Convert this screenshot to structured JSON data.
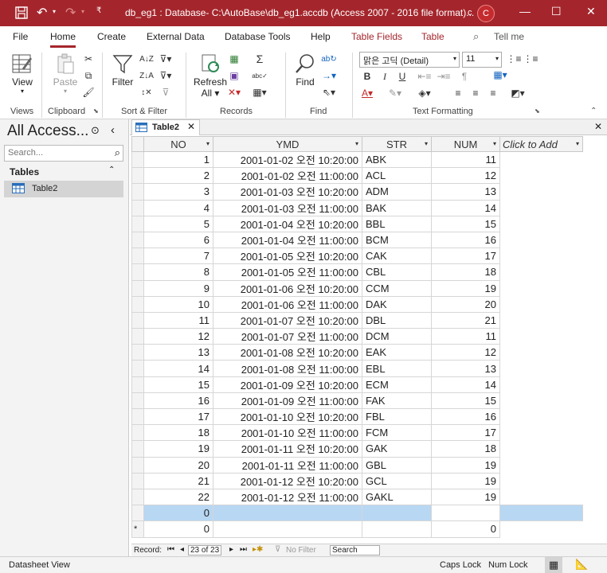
{
  "window": {
    "title": "db_eg1 : Database- C:\\AutoBase\\db_eg1.accdb (Access 2007 - 2016 file format)...",
    "user_initial_small": "c",
    "user_avatar": "C"
  },
  "menu_tabs": [
    "File",
    "Home",
    "Create",
    "External Data",
    "Database Tools",
    "Help",
    "Table Fields",
    "Table"
  ],
  "tell_me": "Tell me",
  "ribbon": {
    "view": "View",
    "paste": "Paste",
    "filter": "Filter",
    "refresh": "Refresh",
    "refresh_all": "All",
    "find": "Find",
    "font_name": "맑은 고딕 (Detail)",
    "font_size": "11",
    "groups": {
      "views": "Views",
      "clipboard": "Clipboard",
      "sort_filter": "Sort & Filter",
      "records": "Records",
      "find": "Find",
      "text_formatting": "Text Formatting"
    },
    "bold": "B",
    "italic": "I",
    "underline": "U"
  },
  "nav": {
    "title": "All Access...",
    "search_placeholder": "Search...",
    "section": "Tables",
    "items": [
      "Table2"
    ]
  },
  "doc_tab": "Table2",
  "grid": {
    "columns": [
      "NO",
      "YMD",
      "STR",
      "NUM",
      "Click to Add"
    ],
    "rows": [
      [
        "1",
        "2001-01-02 오전 10:20:00",
        "ABK",
        "11"
      ],
      [
        "2",
        "2001-01-02 오전 11:00:00",
        "ACL",
        "12"
      ],
      [
        "3",
        "2001-01-03 오전 10:20:00",
        "ADM",
        "13"
      ],
      [
        "4",
        "2001-01-03 오전 11:00:00",
        "BAK",
        "14"
      ],
      [
        "5",
        "2001-01-04 오전 10:20:00",
        "BBL",
        "15"
      ],
      [
        "6",
        "2001-01-04 오전 11:00:00",
        "BCM",
        "16"
      ],
      [
        "7",
        "2001-01-05 오전 10:20:00",
        "CAK",
        "17"
      ],
      [
        "8",
        "2001-01-05 오전 11:00:00",
        "CBL",
        "18"
      ],
      [
        "9",
        "2001-01-06 오전 10:20:00",
        "CCM",
        "19"
      ],
      [
        "10",
        "2001-01-06 오전 11:00:00",
        "DAK",
        "20"
      ],
      [
        "11",
        "2001-01-07 오전 10:20:00",
        "DBL",
        "21"
      ],
      [
        "12",
        "2001-01-07 오전 11:00:00",
        "DCM",
        "11"
      ],
      [
        "13",
        "2001-01-08 오전 10:20:00",
        "EAK",
        "12"
      ],
      [
        "14",
        "2001-01-08 오전 11:00:00",
        "EBL",
        "13"
      ],
      [
        "15",
        "2001-01-09 오전 10:20:00",
        "ECM",
        "14"
      ],
      [
        "16",
        "2001-01-09 오전 11:00:00",
        "FAK",
        "15"
      ],
      [
        "17",
        "2001-01-10 오전 10:20:00",
        "FBL",
        "16"
      ],
      [
        "18",
        "2001-01-10 오전 11:00:00",
        "FCM",
        "17"
      ],
      [
        "19",
        "2001-01-11 오전 10:20:00",
        "GAK",
        "18"
      ],
      [
        "20",
        "2001-01-11 오전 11:00:00",
        "GBL",
        "19"
      ],
      [
        "21",
        "2001-01-12 오전 10:20:00",
        "GCL",
        "19"
      ],
      [
        "22",
        "2001-01-12 오전 11:00:00",
        "GAKL",
        "19"
      ]
    ],
    "selected_row_no": "0",
    "new_row_marker": "*",
    "new_row_no": "0",
    "new_row_num": "0"
  },
  "record_nav": {
    "label": "Record:",
    "position": "23 of 23",
    "filter": "No Filter",
    "search": "Search"
  },
  "status": {
    "left": "Datasheet View",
    "caps": "Caps Lock",
    "num": "Num Lock"
  },
  "colors": {
    "accent": "#a4262c",
    "selected_row": "#b8d7f3"
  }
}
